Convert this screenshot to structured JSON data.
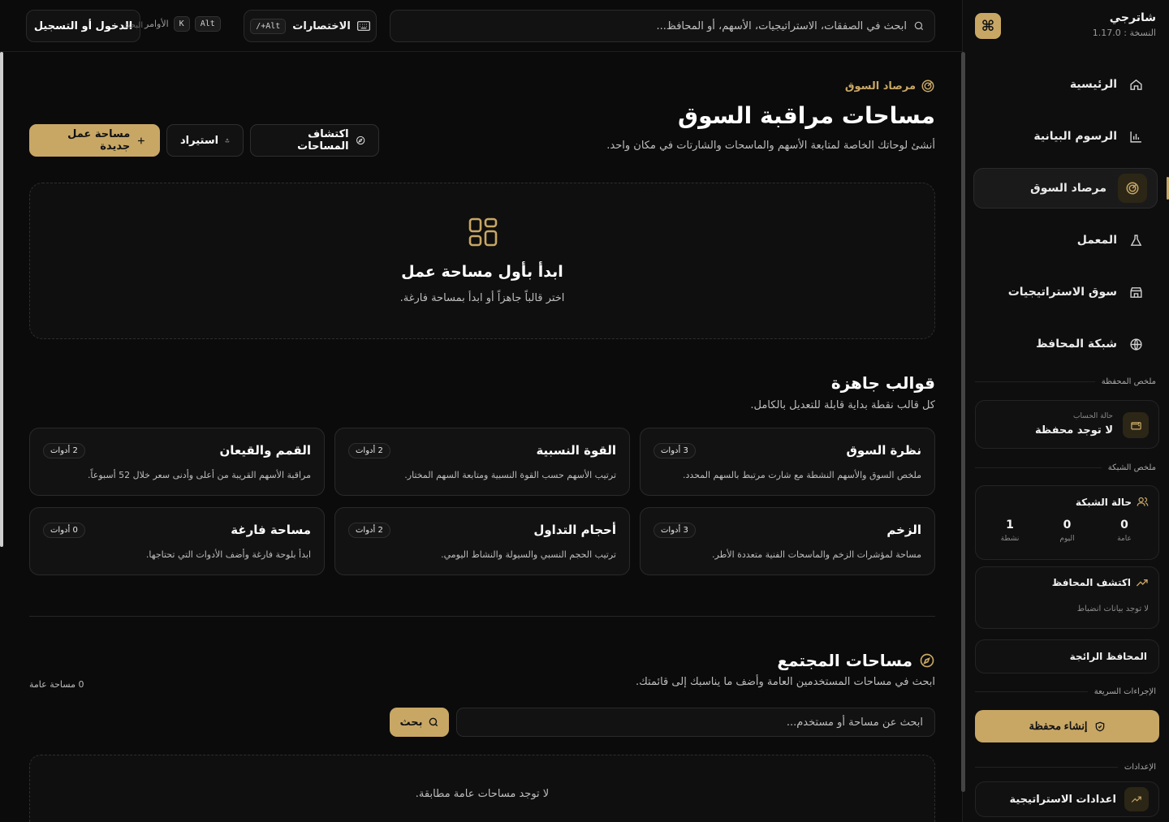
{
  "app": {
    "name": "شاترجي",
    "version": "النسخة : 1.17.0",
    "logo_glyph": "⌘"
  },
  "topbar": {
    "search_placeholder": "ابحث في الصفقات، الاستراتيجيات، الأسهم، أو المحافظ...",
    "shortcuts_label": "الاختصارات",
    "shortcuts_key": "Alt+/",
    "commands_label": "الأوامر",
    "commands_key1": "K",
    "commands_key2": "Alt",
    "login_label": "الدخول أو التسجيل",
    "ghost_text": "البحث"
  },
  "sidebar": {
    "nav": [
      {
        "label": "الرئيسية",
        "icon": "home-icon"
      },
      {
        "label": "الرسوم البيانية",
        "icon": "chart-icon"
      },
      {
        "label": "مرصاد السوق",
        "icon": "radar-icon",
        "active": true
      },
      {
        "label": "المعمل",
        "icon": "flask-icon"
      },
      {
        "label": "سوق الاستراتيجيات",
        "icon": "store-icon"
      },
      {
        "label": "شبكة المحافظ",
        "icon": "globe-icon"
      }
    ],
    "portfolio_summary_label": "ملخص المحفظة",
    "wallet": {
      "label": "حالة الحساب",
      "value": "لا توجد محفظة"
    },
    "network_summary_label": "ملخص الشبكة",
    "network": {
      "title": "حالة الشبكة",
      "stats": [
        {
          "value": "0",
          "label": "عامة"
        },
        {
          "value": "0",
          "label": "اليوم"
        },
        {
          "value": "1",
          "label": "نشطة"
        }
      ]
    },
    "explore": {
      "title": "اكتشف المحافظ",
      "sub": "لا توجد بيانات انضباط"
    },
    "top_wallets": "المحافظ الرائجة",
    "quick_actions_label": "الإجراءات السريعة",
    "create_wallet": "إنشاء محفظة",
    "settings_label": "الإعدادات",
    "strategy_settings": "اعدادات الاستراتيجية"
  },
  "main": {
    "breadcrumb": "مرصاد السوق",
    "title": "مساحات مراقبة السوق",
    "subtitle": "أنشئ لوحاتك الخاصة لمتابعة الأسهم والماسحات والشارتات في مكان واحد.",
    "actions": {
      "explore": "اكتشاف المساحات",
      "import": "استيراد",
      "new": "مساحة عمل جديدة"
    },
    "empty": {
      "title": "ابدأ بأول مساحة عمل",
      "sub": "اختر قالباً جاهزاً أو ابدأ بمساحة فارغة."
    },
    "templates_title": "قوالب جاهزة",
    "templates_sub": "كل قالب نقطة بداية قابلة للتعديل بالكامل.",
    "templates": [
      {
        "name": "نظرة السوق",
        "desc": "ملخص السوق والأسهم النشطة مع شارت مرتبط بالسهم المحدد.",
        "badge": "3 أدوات"
      },
      {
        "name": "القوة النسبية",
        "desc": "ترتيب الأسهم حسب القوة النسبية ومتابعة السهم المختار.",
        "badge": "2 أدوات"
      },
      {
        "name": "القمم والقيعان",
        "desc": "مراقبة الأسهم القريبة من أعلى وأدنى سعر خلال 52 أسبوعاً.",
        "badge": "2 أدوات"
      },
      {
        "name": "الزخم",
        "desc": "مساحة لمؤشرات الزخم والماسحات الفنية متعددة الأطر.",
        "badge": "3 أدوات"
      },
      {
        "name": "أحجام التداول",
        "desc": "ترتيب الحجم النسبي والسيولة والنشاط اليومي.",
        "badge": "2 أدوات"
      },
      {
        "name": "مساحة فارغة",
        "desc": "ابدأ بلوحة فارغة وأضف الأدوات التي تحتاجها.",
        "badge": "0 أدوات"
      }
    ],
    "community": {
      "title": "مساحات المجتمع",
      "sub": "ابحث في مساحات المستخدمين العامة وأضف ما يناسبك إلى قائمتك.",
      "count": "0 مساحة عامة",
      "search_placeholder": "ابحث عن مساحة أو مستخدم...",
      "search_btn": "بحث",
      "empty": "لا توجد مساحات عامة مطابقة."
    }
  },
  "colors": {
    "accent": "#c8a765",
    "bg": "#0b0b0b",
    "card": "#121212"
  }
}
